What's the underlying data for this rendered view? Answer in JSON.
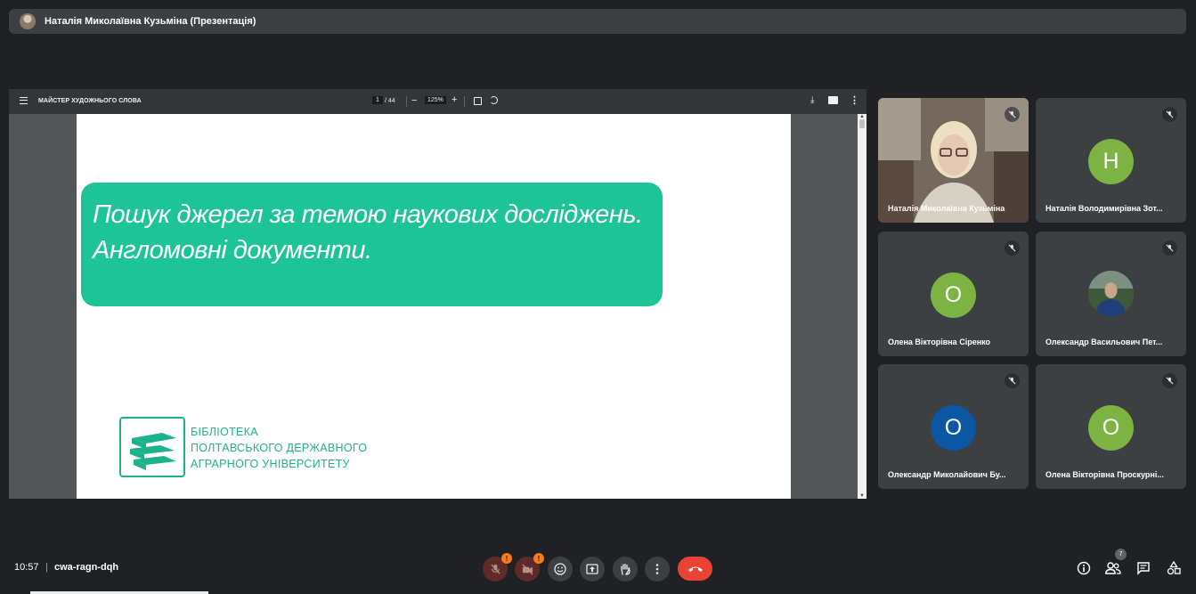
{
  "header": {
    "title": "Наталія Миколаївна Кузьміна (Презентація)"
  },
  "pdf_viewer": {
    "doc_title": "МАЙСТЕР ХУДОЖНЬОГО СЛОВА",
    "page_current": "1",
    "page_total": "/ 44",
    "zoom": "125%",
    "zoom_out": "−",
    "zoom_in": "+",
    "download_glyph": "⤓",
    "more_glyph": "⋮",
    "scroll_up_glyph": "▲",
    "scroll_down_glyph": "▼"
  },
  "slide": {
    "line1": "Пошук джерел за темою наукових досліджень.",
    "line2": "Англомовні документи.",
    "accent_color": "#1cc497",
    "logo_line1": "БІБЛІОТЕКА",
    "logo_line2": "ПОЛТАВСЬКОГО ДЕРЖАВНОГО",
    "logo_line3": "АГРАРНОГО УНІВЕРСИТЕТУ"
  },
  "participants": [
    {
      "name": "Наталія Миколаївна Кузьміна",
      "type": "video"
    },
    {
      "name": "Наталія Володимирівна Зот...",
      "type": "initial",
      "initial": "Н",
      "color": "#7cb342"
    },
    {
      "name": "Олена Вікторівна Сіренко",
      "type": "initial",
      "initial": "О",
      "color": "#7cb342"
    },
    {
      "name": "Олександр Васильович Пет...",
      "type": "photo"
    },
    {
      "name": "Олександр Миколайович Бу...",
      "type": "initial",
      "initial": "О",
      "color": "#0b57a4"
    },
    {
      "name": "Олена Вікторівна Проскурні...",
      "type": "initial",
      "initial": "О",
      "color": "#7cb342"
    }
  ],
  "footer": {
    "time": "10:57",
    "divider": "|",
    "meeting_code": "cwa-ragn-dqh",
    "mic_badge": "!",
    "cam_badge": "!",
    "participant_count": "7"
  },
  "icons": [
    "menu-icon",
    "fit-page-icon",
    "rotate-icon",
    "download-icon",
    "print-icon",
    "more-vert-icon",
    "mic-off-icon",
    "camera-off-icon",
    "emoji-icon",
    "present-icon",
    "raise-hand-icon",
    "hangup-icon",
    "info-icon",
    "people-icon",
    "chat-icon",
    "activities-icon"
  ]
}
